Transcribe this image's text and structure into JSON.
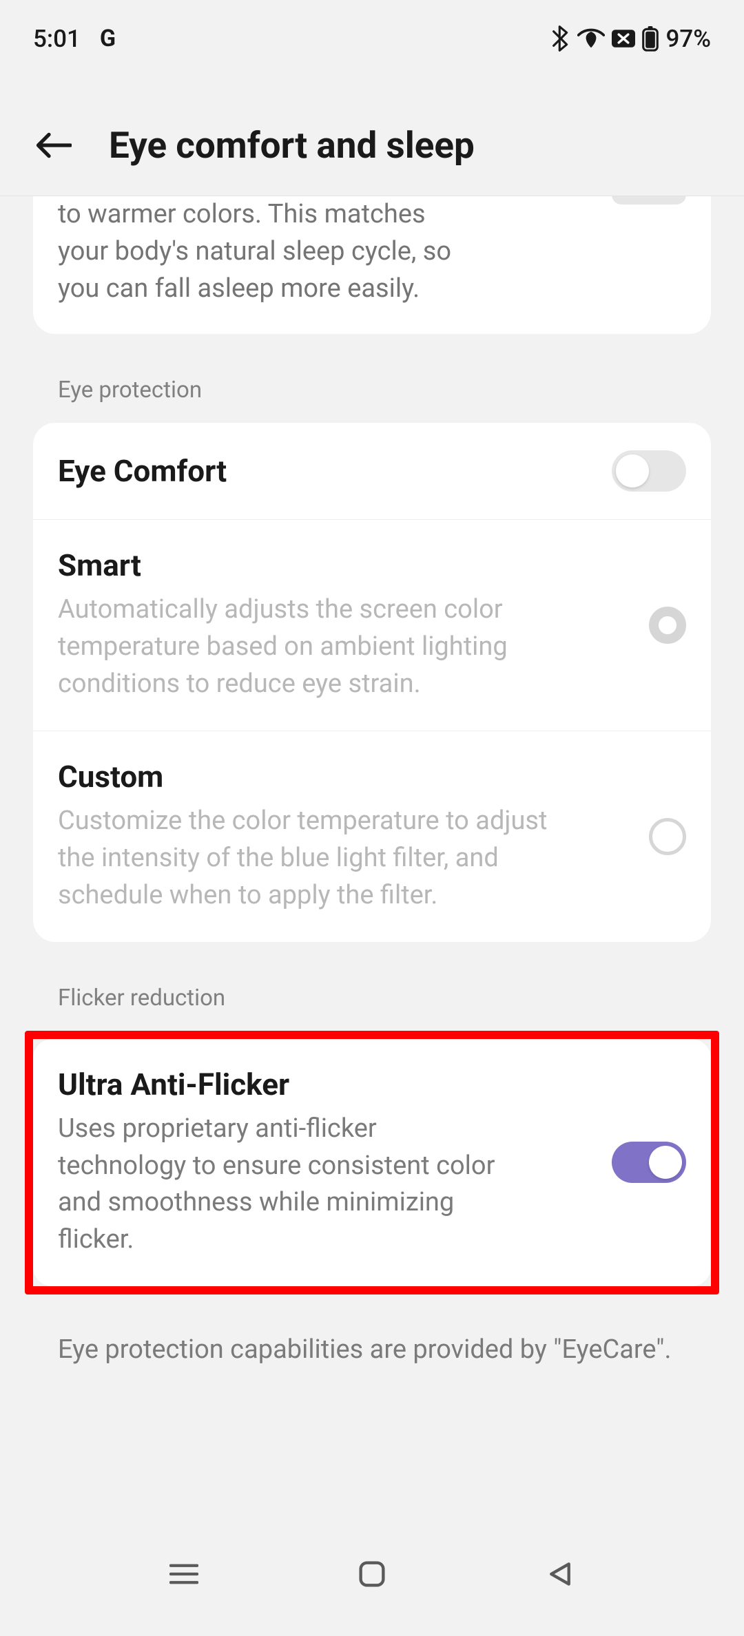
{
  "status": {
    "time": "5:01",
    "assistant_label": "G",
    "battery_pct": "97%"
  },
  "header": {
    "title": "Eye comfort and sleep"
  },
  "bedtime_card": {
    "desc_tail": "to warmer colors. This matches your body's natural sleep cycle, so you can fall asleep more easily."
  },
  "eye_protection": {
    "section_label": "Eye protection",
    "eye_comfort": {
      "title": "Eye Comfort"
    },
    "smart": {
      "title": "Smart",
      "desc": "Automatically adjusts the screen color temperature based on ambient lighting conditions to reduce eye strain."
    },
    "custom": {
      "title": "Custom",
      "desc": "Customize the color temperature to adjust the intensity of the blue light filter, and schedule when to apply the filter."
    }
  },
  "flicker": {
    "section_label": "Flicker reduction",
    "ultra": {
      "title": "Ultra Anti-Flicker",
      "desc": "Uses proprietary anti-flicker technology to ensure consistent color and smoothness while minimizing flicker."
    }
  },
  "footer_note": "Eye protection capabilities are provided by \"EyeCare\".",
  "colors": {
    "accent": "#7f72c7",
    "highlight": "#ff0000"
  }
}
